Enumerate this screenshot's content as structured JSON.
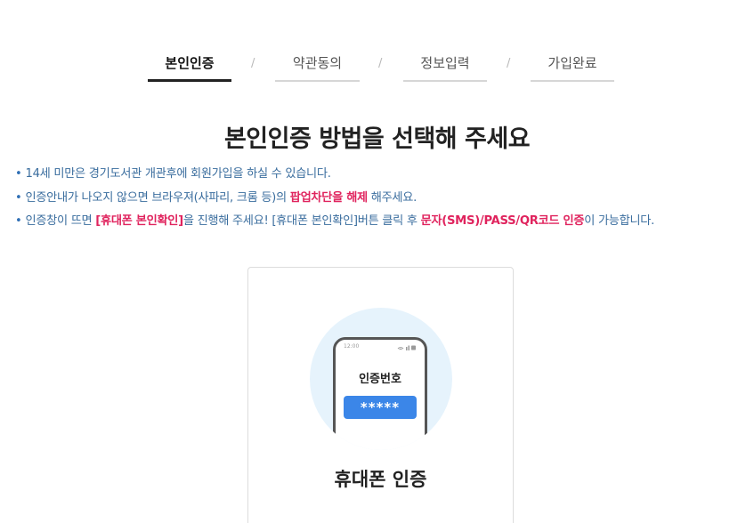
{
  "steps": [
    {
      "label": "본인인증",
      "active": true
    },
    {
      "label": "약관동의",
      "active": false
    },
    {
      "label": "정보입력",
      "active": false
    },
    {
      "label": "가입완료",
      "active": false
    }
  ],
  "step_separator": "/",
  "main_title": "본인인증 방법을 선택해 주세요",
  "bullet": "•",
  "notices": {
    "line1": {
      "text": "14세 미만은 경기도서관 개관후에 회원가입을 하실 수 있습니다."
    },
    "line2": {
      "before": "인증안내가 나오지 않으면 브라우져(사파리, 크롬 등)의 ",
      "highlight": "팝업차단을 해제",
      "after": " 해주세요."
    },
    "line3": {
      "before": "인증창이 뜨면 ",
      "highlight1": "[휴대폰 본인확인]",
      "middle": "을 진행해 주세요! [휴대폰 본인확인]버튼 클릭 후 ",
      "highlight2": "문자(SMS)/PASS/QR코드 인증",
      "after": "이 가능합니다."
    }
  },
  "card": {
    "title": "휴대폰 인증",
    "illustration": {
      "status_time": "12:00",
      "label": "인증번호",
      "pin": "*****"
    }
  },
  "colors": {
    "notice_text": "#3a6d9e",
    "highlight": "#e0245e",
    "circle_bg": "#e6f3fc",
    "pin_bg": "#3b86e8"
  }
}
